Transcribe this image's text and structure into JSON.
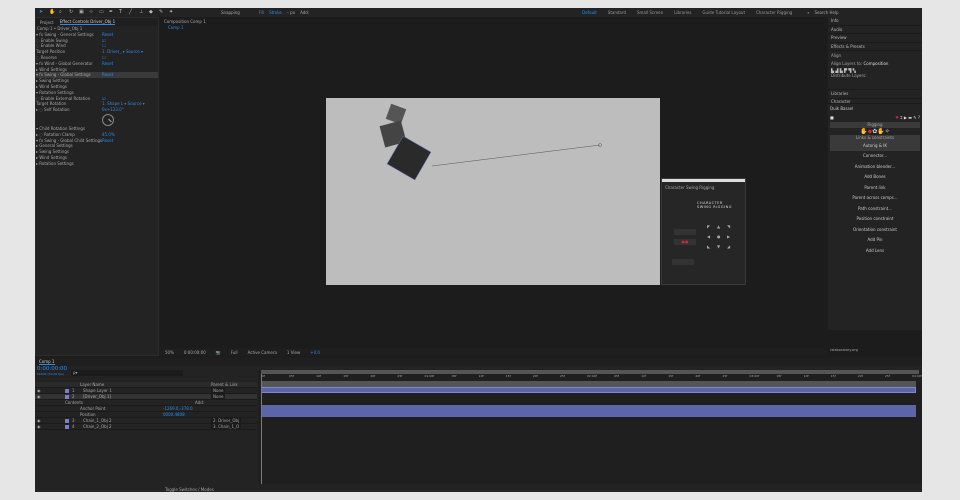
{
  "toolbar": {
    "snapping": "Snapping",
    "fill": "Fill",
    "stroke": "Stroke",
    "stroke_px": "– px",
    "add": "Add:",
    "workspaces": [
      "Default",
      "Standard",
      "Small Screen",
      "Libraries",
      "Guide Tutorial Layout",
      "Character Rigging"
    ],
    "search_placeholder": "Search Help"
  },
  "effect_controls": {
    "tabs": [
      "Project",
      "Effect Controls Driver_Obj 1"
    ],
    "title": "Comp 1 • Driver_Obj 1",
    "rows": [
      {
        "label": "▾ fx Swing - General Settings",
        "value": "Reset"
      },
      {
        "label": "    ◌ Enable Swing",
        "value": "☑"
      },
      {
        "label": "    ◌ Enable Wind",
        "value": "☐"
      },
      {
        "label": "    Target Position",
        "value": "1. Driver_ ▾   Source ▾"
      },
      {
        "label": "    ◌ Reverse",
        "value": "☐"
      },
      {
        "label": "▾ fx Wind - Global Generator",
        "value": "Reset"
      },
      {
        "label": "  ▸ Wind Settings",
        "value": ""
      },
      {
        "label": "▾ fx Swing - Global Settings",
        "value": "Reset"
      },
      {
        "label": "  ▸ Swing Settings",
        "value": ""
      },
      {
        "label": "  ▸ Wind Settings",
        "value": ""
      },
      {
        "label": "  ▾ Rotation Settings",
        "value": ""
      },
      {
        "label": "      ◌ Enable External Rotation",
        "value": "☑"
      },
      {
        "label": "      Target Rotation",
        "value": "1. Shape L ▾  Source ▾"
      },
      {
        "label": "    ▸ ◌ Self Rotation",
        "value": "0x+123.0°"
      }
    ],
    "rows2": [
      {
        "label": "  ▾ Child Rotation Settings",
        "value": ""
      },
      {
        "label": "    ▸ ◌ Rotation Clamp",
        "value": "45.0%"
      },
      {
        "label": "▾ fx Swing - Global Child Settings",
        "value": "Reset"
      },
      {
        "label": "  ▸ General Settings",
        "value": ""
      },
      {
        "label": "  ▸ Swing Settings",
        "value": ""
      },
      {
        "label": "  ▸ Wind Settings",
        "value": ""
      },
      {
        "label": "  ▸ Rotation Settings",
        "value": ""
      }
    ]
  },
  "composition": {
    "tab": "Composition Comp 1",
    "breadcrumb": "Comp 1",
    "footer": {
      "zoom": "50%",
      "timecode": "0:00:00:00",
      "resolution": "Full",
      "camera": "Active Camera",
      "views": "1 View",
      "exposure": "+0.0"
    }
  },
  "swing_panel": {
    "title": "Character Swing Rigging",
    "logo_line1": "CHARACTER",
    "logo_line2": "SWING RIGGING"
  },
  "right_panels": {
    "items": [
      "Info",
      "Audio",
      "Preview",
      "Effects & Presets",
      "Align"
    ],
    "align_to_label": "Align Layers to:",
    "align_to_value": "Composition",
    "distribute_label": "Distribute Layers:",
    "libraries": "Libraries",
    "character": "Character"
  },
  "duik": {
    "title": "Duik Bassel",
    "section_rigging": "Rigging",
    "section_links": "Links & constraints",
    "items": [
      "Autorig & IK",
      "Connector...",
      "Animation blender...",
      "Add Bones",
      "Parent link",
      "Parent across comps...",
      "Path constraint...",
      "Position constraint",
      "Orientation constraint",
      "Add Pin",
      "Add Lens"
    ],
    "footer": "rxlaboratory.org"
  },
  "timeline": {
    "tab": "Comp 1",
    "timecode": "0:00:00:00",
    "fps": "00000 (30.00 fps)",
    "search_placeholder": "ρ▾",
    "col_name": "Layer Name",
    "col_parent": "Parent & Link",
    "contents": "Contents",
    "add": "Add:",
    "layers": [
      {
        "num": "1",
        "name": "Shape Layer 1",
        "parent": "None"
      },
      {
        "num": "2",
        "name": "[Driver_Obj 1]",
        "parent": "None"
      }
    ],
    "props": [
      {
        "name": "Anchor Point",
        "value": "-1269.0,-378.0"
      },
      {
        "name": "Position",
        "value": "0000.4808"
      }
    ],
    "layers2": [
      {
        "num": "3",
        "name": "Chain_1_Obj 2",
        "parent": "2. Driver_Obj"
      },
      {
        "num": "4",
        "name": "Chain_2_Obj 2",
        "parent": "3. Chain_1_O"
      }
    ],
    "ruler": [
      "0f",
      "05f",
      "10f",
      "15f",
      "20f",
      "25f",
      "01:00f",
      "05f",
      "10f",
      "15f",
      "20f",
      "25f",
      "02:00f",
      "05f",
      "10f",
      "15f",
      "20f",
      "25f",
      "03:00f",
      "05f",
      "10f",
      "15f",
      "20f",
      "25f",
      "04:00f"
    ],
    "toggle": "Toggle Switches / Modes"
  },
  "colors": {
    "accent": "#2d8ceb",
    "bar": "#5c65a8",
    "duik_red": "#c8283c"
  }
}
